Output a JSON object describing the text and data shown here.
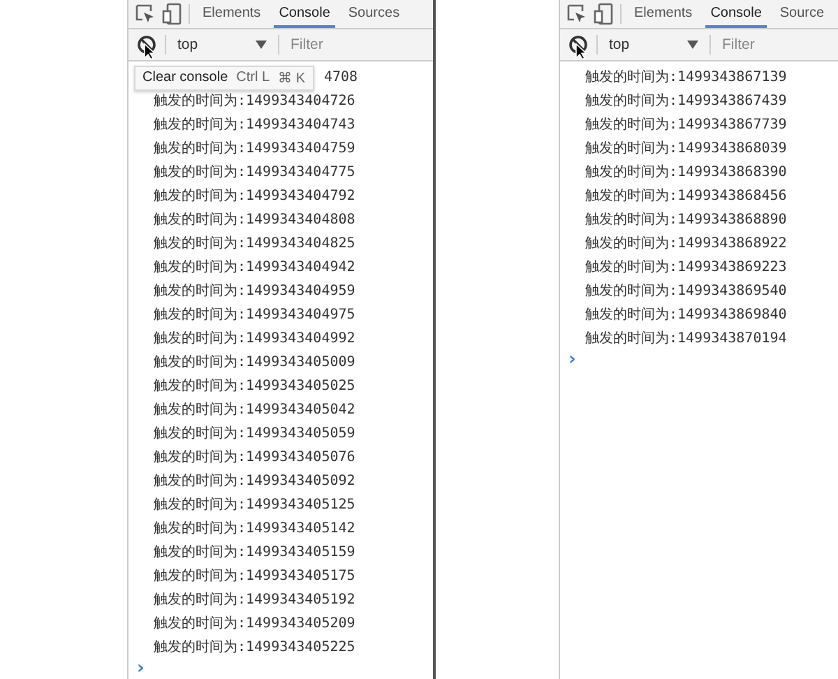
{
  "panels": [
    {
      "tabs": [
        {
          "label": "Elements",
          "selected": false
        },
        {
          "label": "Console",
          "selected": true
        },
        {
          "label": "Sources",
          "selected": false
        }
      ],
      "context": "top",
      "filter_placeholder": "Filter",
      "tooltip": {
        "label": "Clear console",
        "shortcuts": [
          "Ctrl L",
          "⌘ K"
        ]
      },
      "logs": [
        "4708",
        "触发的时间为:1499343404726",
        "触发的时间为:1499343404743",
        "触发的时间为:1499343404759",
        "触发的时间为:1499343404775",
        "触发的时间为:1499343404792",
        "触发的时间为:1499343404808",
        "触发的时间为:1499343404825",
        "触发的时间为:1499343404942",
        "触发的时间为:1499343404959",
        "触发的时间为:1499343404975",
        "触发的时间为:1499343404992",
        "触发的时间为:1499343405009",
        "触发的时间为:1499343405025",
        "触发的时间为:1499343405042",
        "触发的时间为:1499343405059",
        "触发的时间为:1499343405076",
        "触发的时间为:1499343405092",
        "触发的时间为:1499343405125",
        "触发的时间为:1499343405142",
        "触发的时间为:1499343405159",
        "触发的时间为:1499343405175",
        "触发的时间为:1499343405192",
        "触发的时间为:1499343405209",
        "触发的时间为:1499343405225"
      ],
      "prompt": "›"
    },
    {
      "tabs": [
        {
          "label": "Elements",
          "selected": false
        },
        {
          "label": "Console",
          "selected": true
        },
        {
          "label": "Source",
          "selected": false
        }
      ],
      "context": "top",
      "filter_placeholder": "Filter",
      "logs": [
        "触发的时间为:1499343867139",
        "触发的时间为:1499343867439",
        "触发的时间为:1499343867739",
        "触发的时间为:1499343868039",
        "触发的时间为:1499343868390",
        "触发的时间为:1499343868456",
        "触发的时间为:1499343868890",
        "触发的时间为:1499343868922",
        "触发的时间为:1499343869223",
        "触发的时间为:1499343869540",
        "触发的时间为:1499343869840",
        "触发的时间为:1499343870194"
      ],
      "prompt": "›"
    }
  ]
}
